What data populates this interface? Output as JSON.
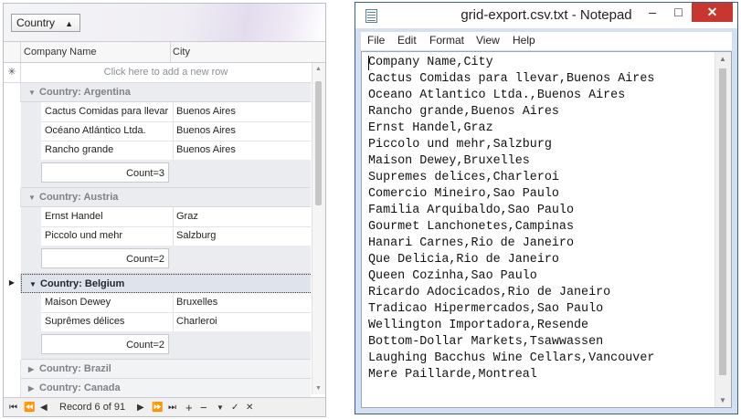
{
  "grid": {
    "group_chip": "Country",
    "columns": [
      "Company Name",
      "City"
    ],
    "new_row_text": "Click here to add a new row",
    "new_row_icon": "✳",
    "groups": [
      {
        "label": "Country: Argentina",
        "state": "expanded",
        "rows": [
          [
            "Cactus Comidas para llevar",
            "Buenos Aires"
          ],
          [
            "Océano Atlántico Ltda.",
            "Buenos Aires"
          ],
          [
            "Rancho grande",
            "Buenos Aires"
          ]
        ],
        "footer": "Count=3"
      },
      {
        "label": "Country: Austria",
        "state": "expanded",
        "rows": [
          [
            "Ernst Handel",
            "Graz"
          ],
          [
            "Piccolo und mehr",
            "Salzburg"
          ]
        ],
        "footer": "Count=2"
      },
      {
        "label": "Country: Belgium",
        "state": "active",
        "rows": [
          [
            "Maison Dewey",
            "Bruxelles"
          ],
          [
            "Suprêmes délices",
            "Charleroi"
          ]
        ],
        "footer": "Count=2"
      },
      {
        "label": "Country: Brazil",
        "state": "collapsed",
        "rows": [],
        "footer": ""
      },
      {
        "label": "Country: Canada",
        "state": "collapsed",
        "rows": [],
        "footer": ""
      }
    ],
    "navigator": {
      "record_text": "Record 6 of 91",
      "first": "⏮",
      "prev_page": "⏪",
      "prev": "◀",
      "next": "▶",
      "next_page": "⏩",
      "last": "⏭",
      "append": "+",
      "remove": "−",
      "edit": "▼",
      "end_edit": "✓",
      "cancel": "✕"
    },
    "icons": {
      "sort_asc": "sort-ascending-icon",
      "expand": "chevron-down-icon",
      "collapse": "chevron-right-icon"
    }
  },
  "notepad": {
    "title": "grid-export.csv.txt - Notepad",
    "window_buttons": {
      "minimize": "–",
      "maximize": "□",
      "close": "✕"
    },
    "menu": [
      "File",
      "Edit",
      "Format",
      "View",
      "Help"
    ],
    "lines": [
      "Company Name,City",
      "Cactus Comidas para llevar,Buenos Aires",
      "Oceano Atlantico Ltda.,Buenos Aires",
      "Rancho grande,Buenos Aires",
      "Ernst Handel,Graz",
      "Piccolo und mehr,Salzburg",
      "Maison Dewey,Bruxelles",
      "Supremes delices,Charleroi",
      "Comercio Mineiro,Sao Paulo",
      "Familia Arquibaldo,Sao Paulo",
      "Gourmet Lanchonetes,Campinas",
      "Hanari Carnes,Rio de Janeiro",
      "Que Delicia,Rio de Janeiro",
      "Queen Cozinha,Sao Paulo",
      "Ricardo Adocicados,Rio de Janeiro",
      "Tradicao Hipermercados,Sao Paulo",
      "Wellington Importadora,Resende",
      "Bottom-Dollar Markets,Tsawwassen",
      "Laughing Bacchus Wine Cellars,Vancouver",
      "Mere Paillarde,Montreal"
    ]
  }
}
